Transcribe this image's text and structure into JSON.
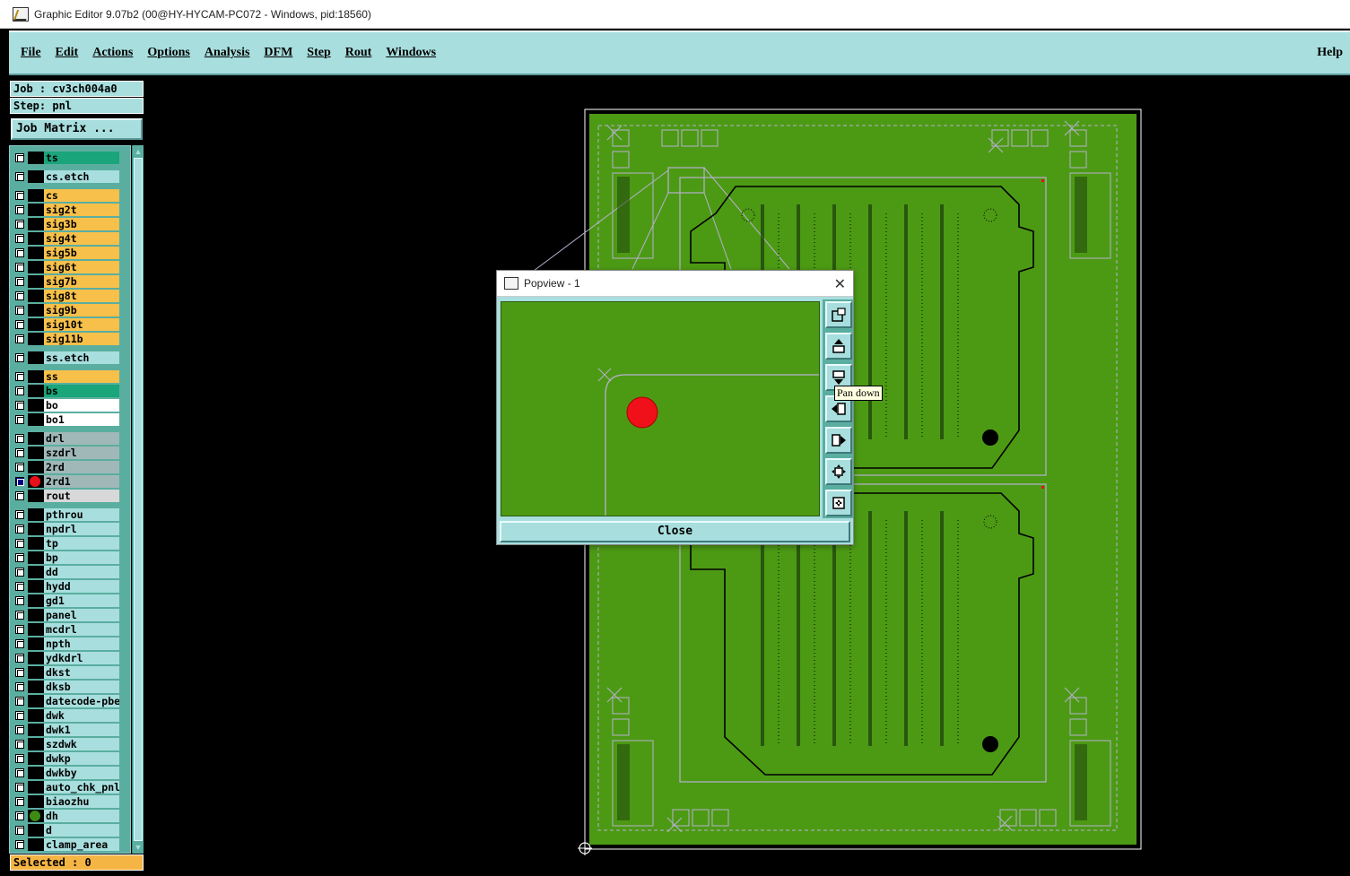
{
  "window": {
    "title": "Graphic Editor 9.07b2 (00@HY-HYCAM-PC072 - Windows, pid:18560)"
  },
  "menu": {
    "items": [
      "File",
      "Edit",
      "Actions",
      "Options",
      "Analysis",
      "DFM",
      "Step",
      "Rout",
      "Windows"
    ],
    "help": "Help"
  },
  "panel": {
    "job": "Job : cv3ch004a0",
    "step": "Step: pnl",
    "job_matrix": "Job Matrix ...",
    "selected": "Selected : 0"
  },
  "layers": [
    {
      "name": "ts",
      "color": "#1aa57a",
      "group": 0
    },
    {
      "name": "cs.etch",
      "color": "#a8dede",
      "group": 1
    },
    {
      "name": "cs",
      "color": "#f7c04a",
      "group": 2
    },
    {
      "name": "sig2t",
      "color": "#f7c04a",
      "group": 2
    },
    {
      "name": "sig3b",
      "color": "#f7c04a",
      "group": 2
    },
    {
      "name": "sig4t",
      "color": "#f7c04a",
      "group": 2
    },
    {
      "name": "sig5b",
      "color": "#f7c04a",
      "group": 2
    },
    {
      "name": "sig6t",
      "color": "#f7c04a",
      "group": 2
    },
    {
      "name": "sig7b",
      "color": "#f7c04a",
      "group": 2
    },
    {
      "name": "sig8t",
      "color": "#f7c04a",
      "group": 2
    },
    {
      "name": "sig9b",
      "color": "#f7c04a",
      "group": 2
    },
    {
      "name": "sig10t",
      "color": "#f7c04a",
      "group": 2
    },
    {
      "name": "sig11b",
      "color": "#f7c04a",
      "group": 2
    },
    {
      "name": "ss.etch",
      "color": "#a8dede",
      "group": 3
    },
    {
      "name": "ss",
      "color": "#f7c04a",
      "group": 4
    },
    {
      "name": "bs",
      "color": "#1aa57a",
      "group": 4
    },
    {
      "name": "bo",
      "color": "#ffffff",
      "group": 4
    },
    {
      "name": "bo1",
      "color": "#ffffff",
      "group": 4
    },
    {
      "name": "drl",
      "color": "#a0b8b8",
      "group": 5
    },
    {
      "name": "szdrl",
      "color": "#a0b8b8",
      "group": 5
    },
    {
      "name": "2rd",
      "color": "#a0b8b8",
      "group": 5
    },
    {
      "name": "2rd1",
      "color": "#a0b8b8",
      "group": 5,
      "active": true,
      "dot": "#e8101a",
      "mark": true
    },
    {
      "name": "rout",
      "color": "#d8d8d8",
      "group": 5
    },
    {
      "name": "pthrou",
      "color": "#a8dede",
      "group": 6
    },
    {
      "name": "npdrl",
      "color": "#a8dede",
      "group": 6
    },
    {
      "name": "tp",
      "color": "#a8dede",
      "group": 6
    },
    {
      "name": "bp",
      "color": "#a8dede",
      "group": 6
    },
    {
      "name": "dd",
      "color": "#a8dede",
      "group": 6
    },
    {
      "name": "hydd",
      "color": "#a8dede",
      "group": 6
    },
    {
      "name": "gd1",
      "color": "#a8dede",
      "group": 6
    },
    {
      "name": "panel",
      "color": "#a8dede",
      "group": 6
    },
    {
      "name": "mcdrl",
      "color": "#a8dede",
      "group": 6
    },
    {
      "name": "npth",
      "color": "#a8dede",
      "group": 6
    },
    {
      "name": "ydkdrl",
      "color": "#a8dede",
      "group": 6
    },
    {
      "name": "dkst",
      "color": "#a8dede",
      "group": 6
    },
    {
      "name": "dksb",
      "color": "#a8dede",
      "group": 6
    },
    {
      "name": "datecode-pbe",
      "color": "#a8dede",
      "group": 6
    },
    {
      "name": "dwk",
      "color": "#a8dede",
      "group": 6
    },
    {
      "name": "dwk1",
      "color": "#a8dede",
      "group": 6
    },
    {
      "name": "szdwk",
      "color": "#a8dede",
      "group": 6
    },
    {
      "name": "dwkp",
      "color": "#a8dede",
      "group": 6
    },
    {
      "name": "dwkby",
      "color": "#a8dede",
      "group": 6
    },
    {
      "name": "auto_chk_pnl",
      "color": "#a8dede",
      "group": 6
    },
    {
      "name": "biaozhu",
      "color": "#a8dede",
      "group": 6
    },
    {
      "name": "dh",
      "color": "#a8dede",
      "group": 6,
      "dot": "#3c8c14"
    },
    {
      "name": "d",
      "color": "#a8dede",
      "group": 6
    },
    {
      "name": "clamp_area",
      "color": "#a8dede",
      "group": 6
    }
  ],
  "popview": {
    "title": "Popview - 1",
    "close_label": "Close",
    "tools": [
      "zoom-window-icon",
      "pan-up-icon",
      "pan-down-icon",
      "pan-left-icon",
      "pan-right-icon",
      "zoom-in-icon",
      "zoom-out-icon"
    ],
    "tooltip": "Pan down"
  },
  "colors": {
    "board": "#4c9a14",
    "menu": "#a8dede",
    "selection": "#e8101a"
  }
}
